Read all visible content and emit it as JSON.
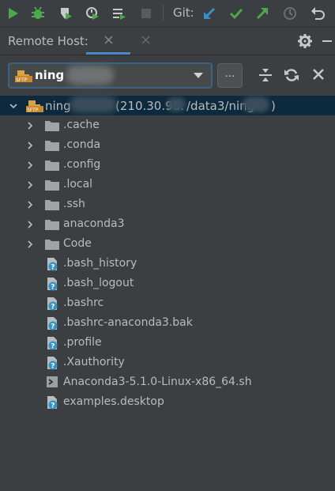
{
  "toolbar": {
    "buttons": [
      {
        "icon": "run-icon",
        "color": "#4fa64f"
      },
      {
        "icon": "debug-icon",
        "color": "#4fa64f"
      },
      {
        "icon": "coverage-icon",
        "color": "#4fa64f"
      },
      {
        "icon": "profile-icon",
        "color": "#4fa64f"
      },
      {
        "icon": "run-config-icon",
        "color": "#c8c8c8"
      },
      {
        "icon": "stop-icon",
        "color": "#5b5b5b"
      }
    ],
    "git_label": "Git:",
    "git_buttons": [
      {
        "icon": "update-project-icon",
        "color": "#3592c4"
      },
      {
        "icon": "commit-icon",
        "color": "#4fa64f"
      },
      {
        "icon": "push-icon",
        "color": "#4fa64f"
      },
      {
        "icon": "history-icon",
        "color": "#6e6e6e"
      },
      {
        "icon": "rollback-icon",
        "color": "#c8c8c8"
      }
    ]
  },
  "panel": {
    "title": "Remote Host:",
    "accent": "#4a88c7"
  },
  "host_selector": {
    "name": "ning",
    "browse_label": "..."
  },
  "tree": {
    "root": {
      "name": "ning",
      "ip_part": "(210.30.96.",
      "path_part": "/data3/ning",
      "tail": ")"
    },
    "folders": [
      ".cache",
      ".conda",
      ".config",
      ".local",
      ".ssh",
      "anaconda3",
      "Code"
    ],
    "files": [
      {
        "name": ".bash_history",
        "icon": "unknown-file-icon"
      },
      {
        "name": ".bash_logout",
        "icon": "unknown-file-icon"
      },
      {
        "name": ".bashrc",
        "icon": "unknown-file-icon"
      },
      {
        "name": ".bashrc-anaconda3.bak",
        "icon": "unknown-file-icon"
      },
      {
        "name": ".profile",
        "icon": "unknown-file-icon"
      },
      {
        "name": ".Xauthority",
        "icon": "unknown-file-icon"
      },
      {
        "name": "Anaconda3-5.1.0-Linux-x86_64.sh",
        "icon": "shell-script-icon"
      },
      {
        "name": "examples.desktop",
        "icon": "unknown-file-icon"
      }
    ]
  }
}
